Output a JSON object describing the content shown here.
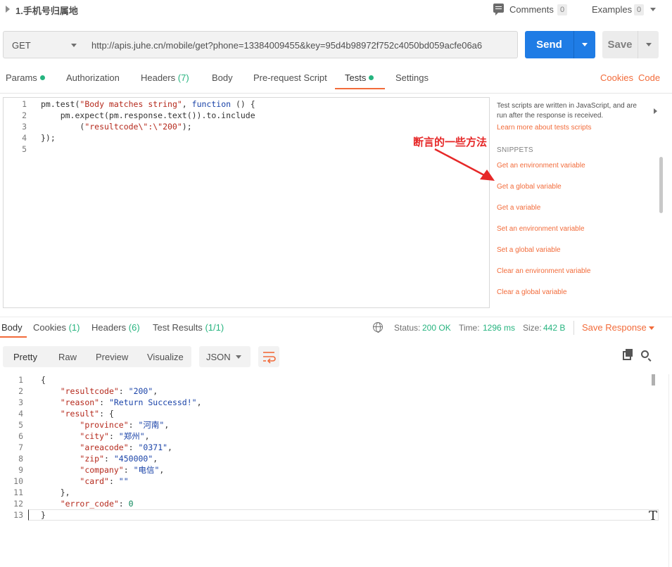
{
  "header": {
    "title": "1.手机号归属地",
    "comments_label": "Comments",
    "comments_count": "0",
    "examples_label": "Examples",
    "examples_count": "0"
  },
  "request": {
    "method": "GET",
    "url": "http://apis.juhe.cn/mobile/get?phone=13384009455&key=95d4b98972f752c4050bd059acfe06a6",
    "send_label": "Send",
    "save_label": "Save"
  },
  "request_tabs": {
    "params": "Params",
    "authorization": "Authorization",
    "headers": "Headers",
    "headers_count": "(7)",
    "body": "Body",
    "pre_request": "Pre-request Script",
    "tests": "Tests",
    "settings": "Settings",
    "cookies": "Cookies",
    "code": "Code",
    "active": "Tests"
  },
  "editor": {
    "lines": [
      {
        "n": "1",
        "t": "pm.test(\"Body matches string\", function () {"
      },
      {
        "n": "2",
        "t": "    pm.expect(pm.response.text()).to.include"
      },
      {
        "n": "3",
        "t": "        (\"resultcode\\\":\\\"200\");"
      },
      {
        "n": "4",
        "t": "});"
      },
      {
        "n": "5",
        "t": ""
      }
    ]
  },
  "snippets": {
    "description": "Test scripts are written in JavaScript, and are run after the response is received.",
    "learn_more": "Learn more about tests scripts",
    "heading": "SNIPPETS",
    "items": [
      "Get an environment variable",
      "Get a global variable",
      "Get a variable",
      "Set an environment variable",
      "Set a global variable",
      "Clear an environment variable",
      "Clear a global variable"
    ]
  },
  "annotation": {
    "text": "断言的一些方法",
    "color": "#e62828"
  },
  "response": {
    "tabs": {
      "body": "Body",
      "cookies": "Cookies",
      "cookies_count": "(1)",
      "headers": "Headers",
      "headers_count": "(6)",
      "test_results": "Test Results",
      "test_results_count": "(1/1)"
    },
    "status_label": "Status:",
    "status_value": "200 OK",
    "time_label": "Time:",
    "time_value": "1296 ms",
    "size_label": "Size:",
    "size_value": "442 B",
    "save_response": "Save Response",
    "view_modes": [
      "Pretty",
      "Raw",
      "Preview",
      "Visualize"
    ],
    "format": "JSON",
    "json_lines": [
      {
        "n": "1",
        "t": "{"
      },
      {
        "n": "2",
        "t": "    \"resultcode\": \"200\","
      },
      {
        "n": "3",
        "t": "    \"reason\": \"Return Successd!\","
      },
      {
        "n": "4",
        "t": "    \"result\": {"
      },
      {
        "n": "5",
        "t": "        \"province\": \"河南\","
      },
      {
        "n": "6",
        "t": "        \"city\": \"郑州\","
      },
      {
        "n": "7",
        "t": "        \"areacode\": \"0371\","
      },
      {
        "n": "8",
        "t": "        \"zip\": \"450000\","
      },
      {
        "n": "9",
        "t": "        \"company\": \"电信\","
      },
      {
        "n": "10",
        "t": "        \"card\": \"\""
      },
      {
        "n": "11",
        "t": "    },"
      },
      {
        "n": "12",
        "t": "    \"error_code\": 0"
      },
      {
        "n": "13",
        "t": "}"
      }
    ]
  },
  "colors": {
    "accent_orange": "#f26b3a",
    "send_blue": "#1f7ce5",
    "success_green": "#26b47f"
  }
}
